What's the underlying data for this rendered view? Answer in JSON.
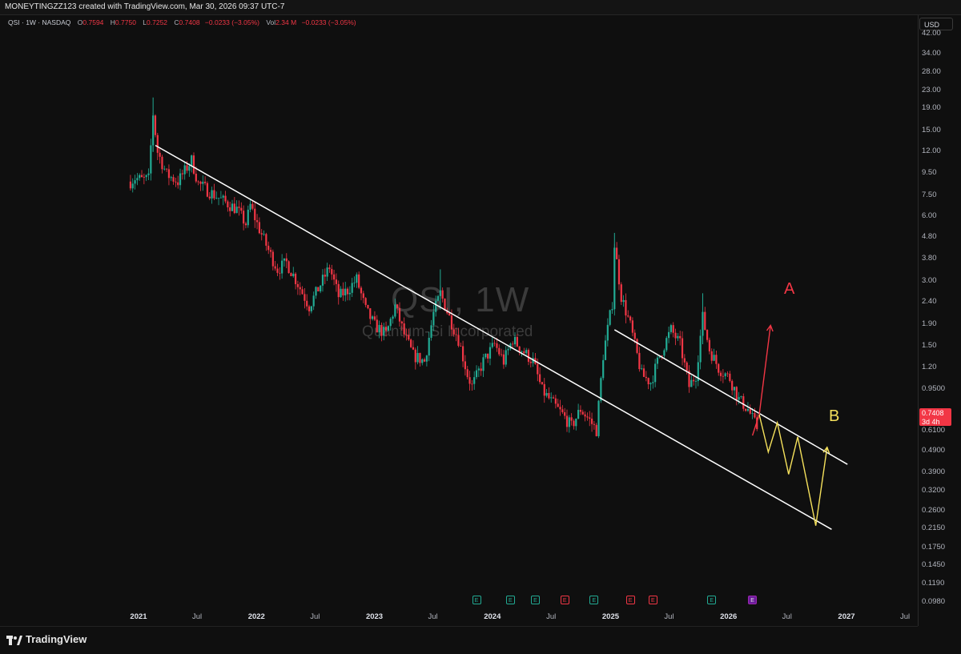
{
  "header": {
    "caption": "MONEYTINGZZ123 created with TradingView.com, Mar 30, 2026 09:37 UTC-7"
  },
  "legend": {
    "symbol": "QSI · 1W · NASDAQ",
    "open_label": "O",
    "open": "0.7594",
    "high_label": "H",
    "high": "0.7750",
    "low_label": "L",
    "low": "0.7252",
    "close_label": "C",
    "close": "0.7408",
    "change": "−0.0233 (−3.05%)",
    "vol_label": "Vol",
    "vol": "2.34 M",
    "vol_change": "−0.0233 (−3.05%)"
  },
  "watermark": {
    "title": "QSI, 1W",
    "subtitle": "Quantum-Si Incorporated"
  },
  "price_scale": {
    "currency": "USD",
    "last_price": "0.7408",
    "countdown": "3d 4h",
    "last_price_color": "#f23645"
  },
  "annotations": {
    "label_a": "A",
    "label_b": "B",
    "color_a": "#f23645",
    "color_b": "#f5e15c"
  },
  "earnings_icon": "E",
  "branding": {
    "logo_text": "TradingView"
  },
  "colors": {
    "up": "#22ab94",
    "down": "#f23645",
    "trendline": "#ffffff"
  },
  "chart_data": {
    "type": "candlestick",
    "scale": "log",
    "y_ticks": [
      42.0,
      34.0,
      28.0,
      23.0,
      19.0,
      15.0,
      12.0,
      9.5,
      7.5,
      6.0,
      4.8,
      3.8,
      3.0,
      2.4,
      1.9,
      1.5,
      1.2,
      0.95,
      0.61,
      0.49,
      0.39,
      0.32,
      0.26,
      0.215,
      0.175,
      0.145,
      0.119,
      0.098
    ],
    "y_tick_labels": [
      "42.00",
      "34.00",
      "28.00",
      "23.00",
      "19.00",
      "15.00",
      "12.00",
      "9.50",
      "7.50",
      "6.00",
      "4.80",
      "3.80",
      "3.00",
      "2.40",
      "1.90",
      "1.50",
      "1.20",
      "0.9500",
      "0.6100",
      "0.4900",
      "0.3900",
      "0.3200",
      "0.2600",
      "0.2150",
      "0.1750",
      "0.1450",
      "0.1190",
      "0.0980"
    ],
    "x_ticks": [
      {
        "label": "2021",
        "year": true
      },
      {
        "label": "Jul",
        "year": false
      },
      {
        "label": "2022",
        "year": true
      },
      {
        "label": "Jul",
        "year": false
      },
      {
        "label": "2023",
        "year": true
      },
      {
        "label": "Jul",
        "year": false
      },
      {
        "label": "2024",
        "year": true
      },
      {
        "label": "Jul",
        "year": false
      },
      {
        "label": "2025",
        "year": true
      },
      {
        "label": "Jul",
        "year": false
      },
      {
        "label": "2026",
        "year": true
      },
      {
        "label": "Jul",
        "year": false
      },
      {
        "label": "2027",
        "year": true
      },
      {
        "label": "Jul",
        "year": false
      }
    ],
    "price_path": [
      [
        "2020-12-07",
        10.2
      ],
      [
        "2020-12-21",
        10.6
      ],
      [
        "2021-01-11",
        10.4
      ],
      [
        "2021-02-01",
        10.5
      ],
      [
        "2021-02-15",
        21.0
      ],
      [
        "2021-03-01",
        14.0
      ],
      [
        "2021-03-29",
        11.0
      ],
      [
        "2021-05-03",
        10.2
      ],
      [
        "2021-06-14",
        12.8
      ],
      [
        "2021-07-05",
        10.0
      ],
      [
        "2021-08-16",
        9.0
      ],
      [
        "2021-09-20",
        8.3
      ],
      [
        "2021-11-01",
        7.6
      ],
      [
        "2021-11-29",
        6.5
      ],
      [
        "2021-12-13",
        7.9
      ],
      [
        "2022-01-03",
        6.5
      ],
      [
        "2022-02-07",
        4.9
      ],
      [
        "2022-03-07",
        4.0
      ],
      [
        "2022-04-04",
        4.3
      ],
      [
        "2022-05-02",
        3.6
      ],
      [
        "2022-06-13",
        2.7
      ],
      [
        "2022-07-04",
        3.1
      ],
      [
        "2022-08-15",
        4.1
      ],
      [
        "2022-09-12",
        3.0
      ],
      [
        "2022-10-10",
        3.2
      ],
      [
        "2022-11-07",
        3.6
      ],
      [
        "2022-12-05",
        2.6
      ],
      [
        "2023-01-02",
        2.2
      ],
      [
        "2023-02-06",
        2.0
      ],
      [
        "2023-03-06",
        2.7
      ],
      [
        "2023-04-03",
        2.0
      ],
      [
        "2023-05-01",
        1.6
      ],
      [
        "2023-06-05",
        1.5
      ],
      [
        "2023-07-03",
        2.5
      ],
      [
        "2023-07-24",
        3.1
      ],
      [
        "2023-08-21",
        2.4
      ],
      [
        "2023-09-18",
        1.9
      ],
      [
        "2023-10-16",
        1.3
      ],
      [
        "2023-10-30",
        1.15
      ],
      [
        "2023-12-04",
        1.5
      ],
      [
        "2024-01-08",
        1.8
      ],
      [
        "2024-02-05",
        1.5
      ],
      [
        "2024-03-04",
        1.9
      ],
      [
        "2024-04-01",
        1.7
      ],
      [
        "2024-05-06",
        1.5
      ],
      [
        "2024-06-03",
        1.1
      ],
      [
        "2024-07-08",
        0.95
      ],
      [
        "2024-08-05",
        0.85
      ],
      [
        "2024-09-02",
        0.75
      ],
      [
        "2024-09-30",
        0.9
      ],
      [
        "2024-10-28",
        0.8
      ],
      [
        "2024-11-18",
        0.72
      ],
      [
        "2024-12-09",
        1.6
      ],
      [
        "2025-01-06",
        2.8
      ],
      [
        "2025-01-13",
        5.2
      ],
      [
        "2025-02-03",
        3.0
      ],
      [
        "2025-03-03",
        2.2
      ],
      [
        "2025-04-07",
        1.3
      ],
      [
        "2025-05-05",
        1.2
      ],
      [
        "2025-06-02",
        1.6
      ],
      [
        "2025-07-07",
        2.1
      ],
      [
        "2025-08-04",
        1.8
      ],
      [
        "2025-09-01",
        1.15
      ],
      [
        "2025-09-22",
        1.3
      ],
      [
        "2025-10-13",
        2.4
      ],
      [
        "2025-11-03",
        1.7
      ],
      [
        "2025-12-01",
        1.4
      ],
      [
        "2026-01-05",
        1.25
      ],
      [
        "2026-02-02",
        1.0
      ],
      [
        "2026-03-02",
        0.9
      ],
      [
        "2026-03-30",
        0.74
      ]
    ],
    "candle_range": {
      "start": "2020-12-07",
      "end": "2026-03-30",
      "step_days": 7
    },
    "trendlines": [
      {
        "from": [
          "2021-02-22",
          15.0
        ],
        "to": [
          "2026-11-16",
          0.25
        ]
      },
      {
        "from": [
          "2025-01-13",
          2.1
        ],
        "to": [
          "2027-01-04",
          0.5
        ]
      }
    ],
    "projection_a": [
      [
        "2026-03-16",
        0.68
      ],
      [
        "2026-04-06",
        0.85
      ],
      [
        "2026-05-11",
        2.2
      ]
    ],
    "projection_b": [
      [
        "2026-04-06",
        0.85
      ],
      [
        "2026-05-04",
        0.57
      ],
      [
        "2026-06-01",
        0.78
      ],
      [
        "2026-07-06",
        0.45
      ],
      [
        "2026-08-03",
        0.67
      ],
      [
        "2026-09-28",
        0.26
      ],
      [
        "2026-11-02",
        0.6
      ]
    ],
    "earnings": [
      {
        "date": "2023-11-13",
        "kind": "pos"
      },
      {
        "date": "2024-02-26",
        "kind": "pos"
      },
      {
        "date": "2024-05-13",
        "kind": "pos"
      },
      {
        "date": "2024-08-12",
        "kind": "neg"
      },
      {
        "date": "2024-11-11",
        "kind": "pos"
      },
      {
        "date": "2025-03-03",
        "kind": "neg"
      },
      {
        "date": "2025-05-12",
        "kind": "neg"
      },
      {
        "date": "2025-11-10",
        "kind": "pos"
      },
      {
        "date": "2026-03-16",
        "kind": "fut"
      }
    ]
  }
}
